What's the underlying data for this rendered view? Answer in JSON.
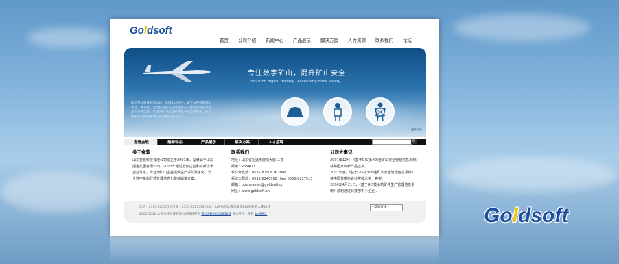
{
  "brand": {
    "logo_prefix": "Go",
    "logo_o": "l",
    "logo_suffix": "dsoft"
  },
  "nav": [
    "首页",
    "公司介绍",
    "新闻中心",
    "产品展示",
    "解决方案",
    "人力资源",
    "联系我们",
    "论坛"
  ],
  "banner": {
    "title": "专注数字矿山，提升矿山安全",
    "subtitle": "Focus on digital mining，Ascending mine safety",
    "intro": "山东金软科技有限公司，是煤矿山生产、安全与经营管理信息化、数字化、自动化系统与应用服务于一体的高新技术企业和软件企业。专注为矿山企业提供生产安全数字化、安全数字化和经营管理信息化整体解决方案。",
    "more": "更多科技"
  },
  "tabs": [
    "走进金软",
    "最新动态",
    "产品展示",
    "解决方案",
    "人才招聘"
  ],
  "search_btn": "Q",
  "about": {
    "title": "关于金软",
    "text": "山东金软科技有限公司成立于2001年，是隶属于山东招金集团有限公司，2003年通过软件企业和高新技术企业认定。专业为矿山企业提供生产采矿数字化、安全数字化和经营管理信息化整体解决方案。"
  },
  "contact": {
    "title": "联系我们",
    "lines": [
      "地址：山东省招远市府前大厦11楼",
      "邮编：265400",
      "软件开发部：0535-8250676 (fax)",
      "系统工程部：0535-8240708 (fax)  0535-8227513",
      "邮箱：postmaster@goldsoft.cn",
      "网址：www.goldsoft.cn"
    ]
  },
  "events": {
    "title": "公司大事记",
    "lines": [
      "2007年12月，《基于GIS技术的金矿山安全管理信息系统》获得国家高新产品证书。",
      "2007年度，《基于GIS技术的金矿山安全管理信息系统》获中国黄金协会科学技术奖一等奖。",
      "2006年4月21日，《基于GIS技术的矿井生产管理信息系统》顺利通过科技部中小企业..."
    ]
  },
  "footer": {
    "line1": "电话：0535-8250676  传真：0535-8227513  地址：山东省招远市温泉路234号府前大厦11楼",
    "line2_prefix": "2001-2010  山东金软科技有限公司版权所有 ",
    "icp": "鲁ICP备06002836号",
    "line2_mid": " 技术支持：金软 ",
    "stats": "站长统计",
    "friends": "--友情连接--"
  },
  "big_logo": {
    "prefix": "Go",
    "o": "l",
    "suffix": "dsoft"
  },
  "colors": {
    "brand_blue": "#1b4f9b",
    "accent_yellow": "#f2c400",
    "banner_top": "#0f4e86"
  }
}
